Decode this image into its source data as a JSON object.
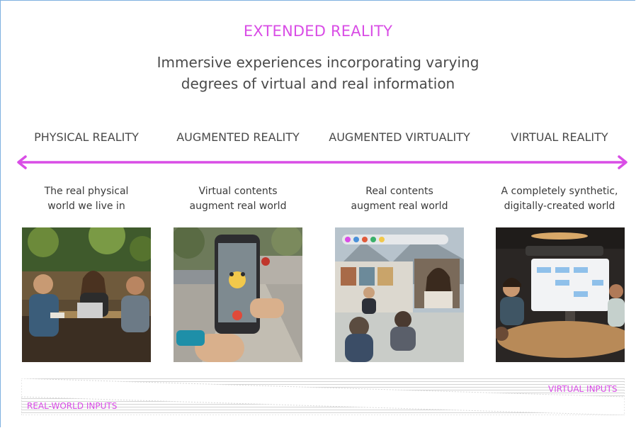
{
  "title": "EXTENDED REALITY",
  "subtitle": "Immersive experiences incorporating varying\ndegrees of virtual and real information",
  "columns": [
    {
      "heading": "PHYSICAL REALITY",
      "description": "The real physical\nworld we live in",
      "image": "people-at-cafe-table-photo"
    },
    {
      "heading": "AUGMENTED REALITY",
      "description": "Virtual contents\naugment real world",
      "image": "phone-ar-game-photo"
    },
    {
      "heading": "AUGMENTED VIRTUALITY",
      "description": "Real contents\naugment real world",
      "image": "avatar-video-call-photo"
    },
    {
      "heading": "VIRTUAL REALITY",
      "description": "A completely synthetic,\ndigitally-created world",
      "image": "vr-meeting-room-render"
    }
  ],
  "inputs": {
    "virtual_label": "VIRTUAL INPUTS",
    "real_label": "REAL-WORLD INPUTS"
  },
  "colors": {
    "accent": "#d94de6",
    "text": "#4a4a4a",
    "frame": "#7fb0e0"
  }
}
